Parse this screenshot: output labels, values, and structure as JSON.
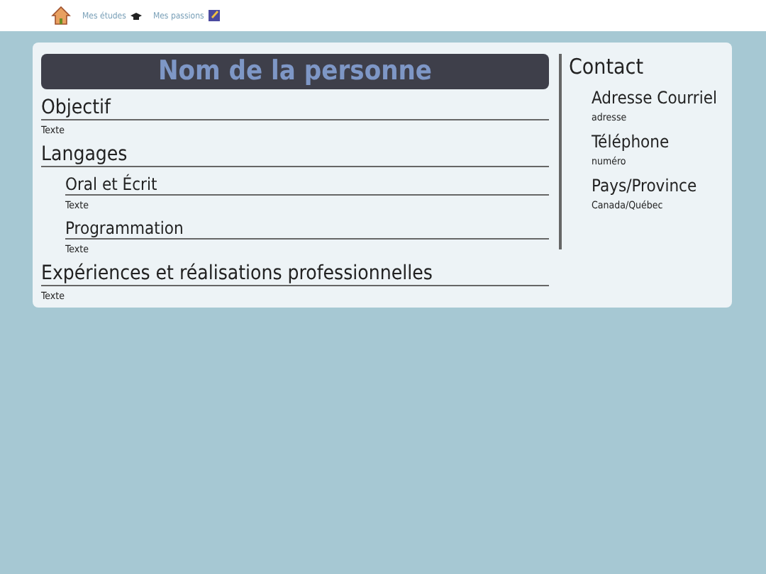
{
  "nav": {
    "links": [
      {
        "label": "Mes études",
        "kind": "studies"
      },
      {
        "label": "Mes passions",
        "kind": "passions"
      }
    ]
  },
  "name": "Nom de la personne",
  "sections": [
    {
      "title": "Objectif",
      "text": "Texte"
    },
    {
      "title": "Langages",
      "children": [
        {
          "title": "Oral et Écrit",
          "text": "Texte"
        },
        {
          "title": "Programmation",
          "text": "Texte"
        }
      ]
    },
    {
      "title": "Expériences et réalisations professionnelles",
      "text": "Texte"
    }
  ],
  "contact": {
    "title": "Contact",
    "items": [
      {
        "label": "Adresse Courriel",
        "value": "adresse"
      },
      {
        "label": "Téléphone",
        "value": "numéro"
      },
      {
        "label": "Pays/Province",
        "value": "Canada/Québec"
      }
    ]
  }
}
